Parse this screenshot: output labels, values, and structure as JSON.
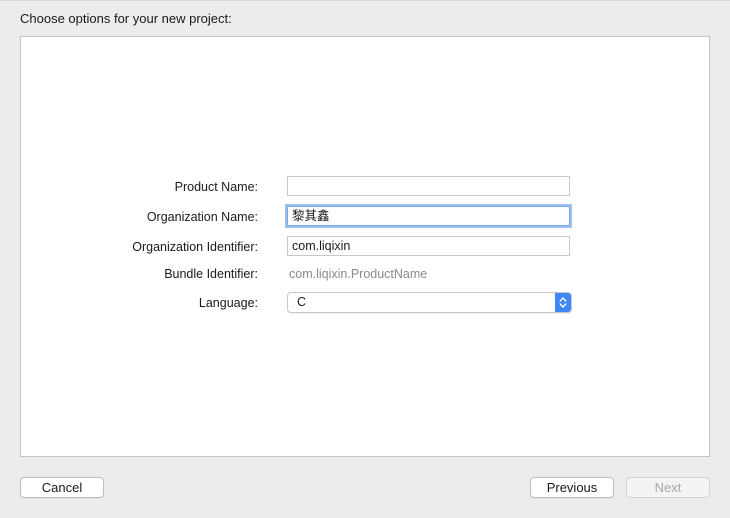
{
  "dialog": {
    "heading": "Choose options for your new project:"
  },
  "form": {
    "product_name": {
      "label": "Product Name:",
      "value": ""
    },
    "organization_name": {
      "label": "Organization Name:",
      "value": "黎其鑫"
    },
    "organization_identifier": {
      "label": "Organization Identifier:",
      "value": "com.liqixin"
    },
    "bundle_identifier": {
      "label": "Bundle Identifier:",
      "value": "com.liqixin.ProductName"
    },
    "language": {
      "label": "Language:",
      "value": "C"
    }
  },
  "buttons": {
    "cancel": "Cancel",
    "previous": "Previous",
    "next": "Next"
  },
  "colors": {
    "focus_ring": "#9cc0f0",
    "popup_stepper": "#3f86f7",
    "muted_text": "#8a8a8a"
  },
  "icons": {
    "popup_stepper": "chevron-up-down-icon"
  }
}
